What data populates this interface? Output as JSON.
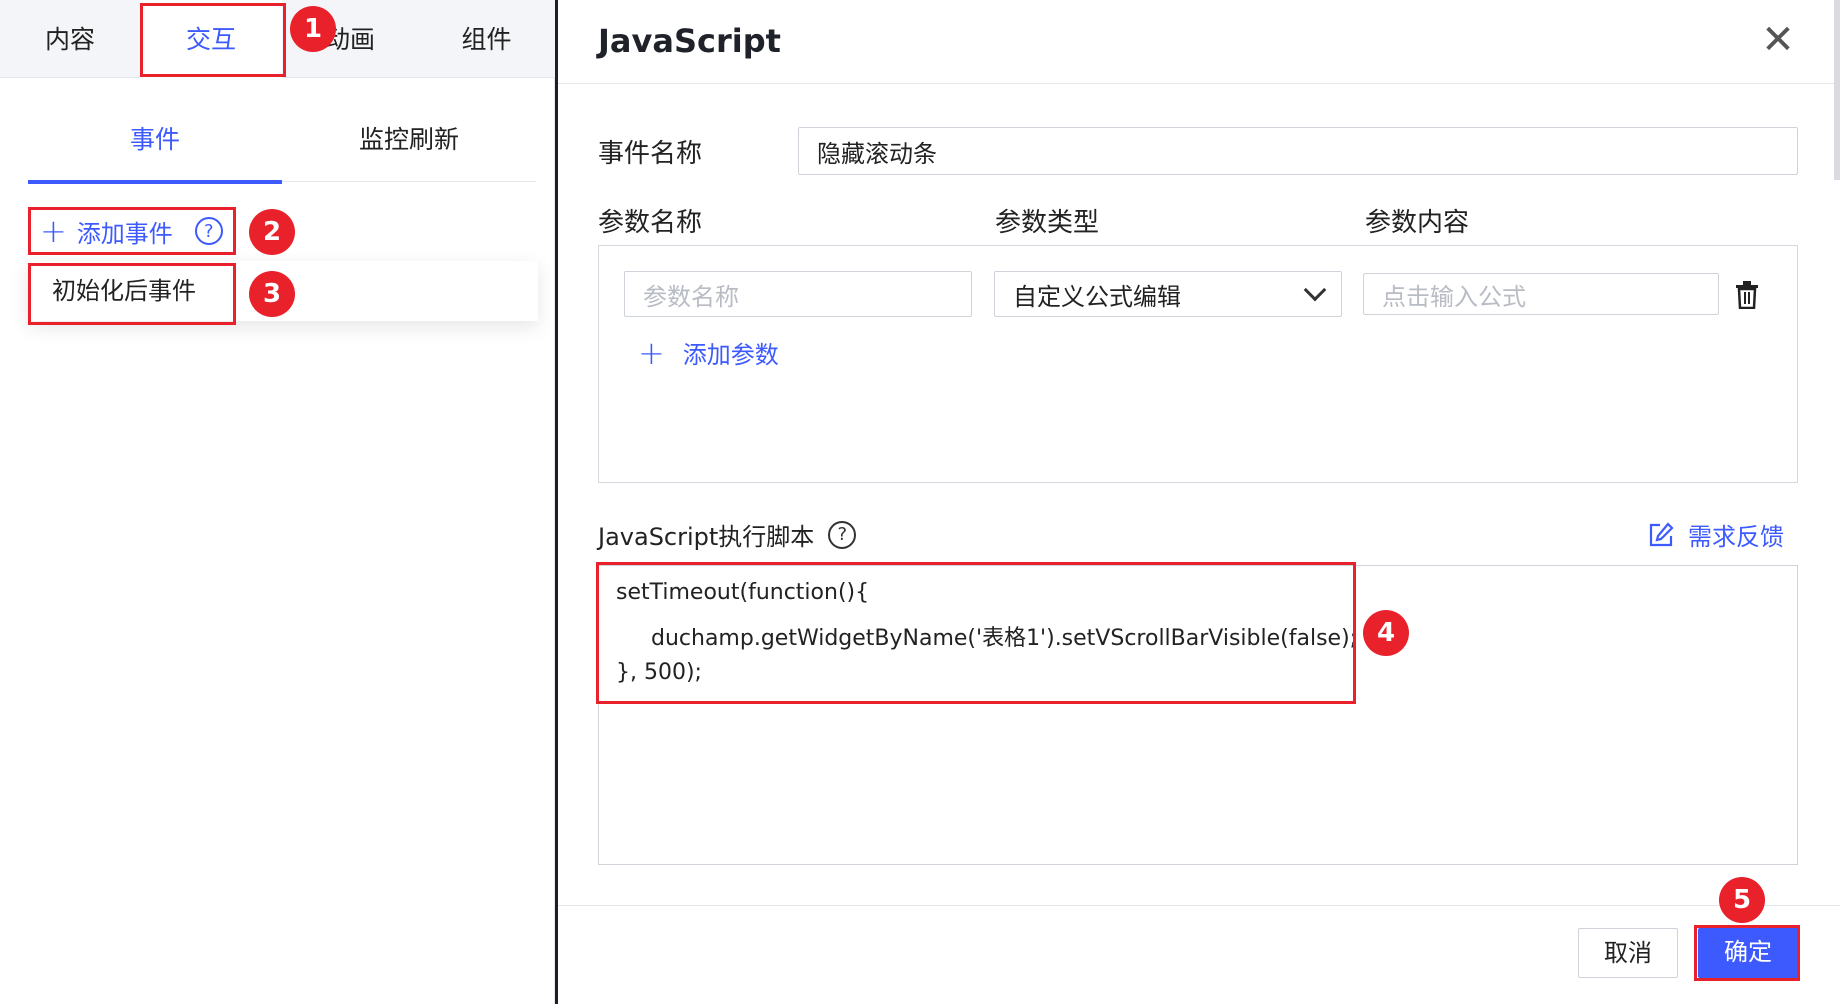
{
  "left_panel": {
    "top_tabs": [
      "内容",
      "交互",
      "动画",
      "组件"
    ],
    "sub_tabs": [
      "事件",
      "监控刷新"
    ],
    "add_event_label": "添加事件",
    "event_item": "初始化后事件"
  },
  "dialog": {
    "title": "JavaScript",
    "event_name_label": "事件名称",
    "event_name_value": "隐藏滚动条",
    "param_headers": [
      "参数名称",
      "参数类型",
      "参数内容"
    ],
    "param_name_placeholder": "参数名称",
    "param_type_value": "自定义公式编辑",
    "param_content_placeholder": "点击输入公式",
    "add_param_label": "添加参数",
    "script_label": "JavaScript执行脚本",
    "feedback_label": "需求反馈",
    "code_lines": [
      "setTimeout(function(){",
      "duchamp.getWidgetByName('表格1').setVScrollBarVisible(false);",
      "}, 500);"
    ],
    "cancel_label": "取消",
    "ok_label": "确定"
  },
  "annotations": [
    "1",
    "2",
    "3",
    "4",
    "5"
  ],
  "colors": {
    "accent": "#3d5afe",
    "annotation": "#e8212b"
  }
}
